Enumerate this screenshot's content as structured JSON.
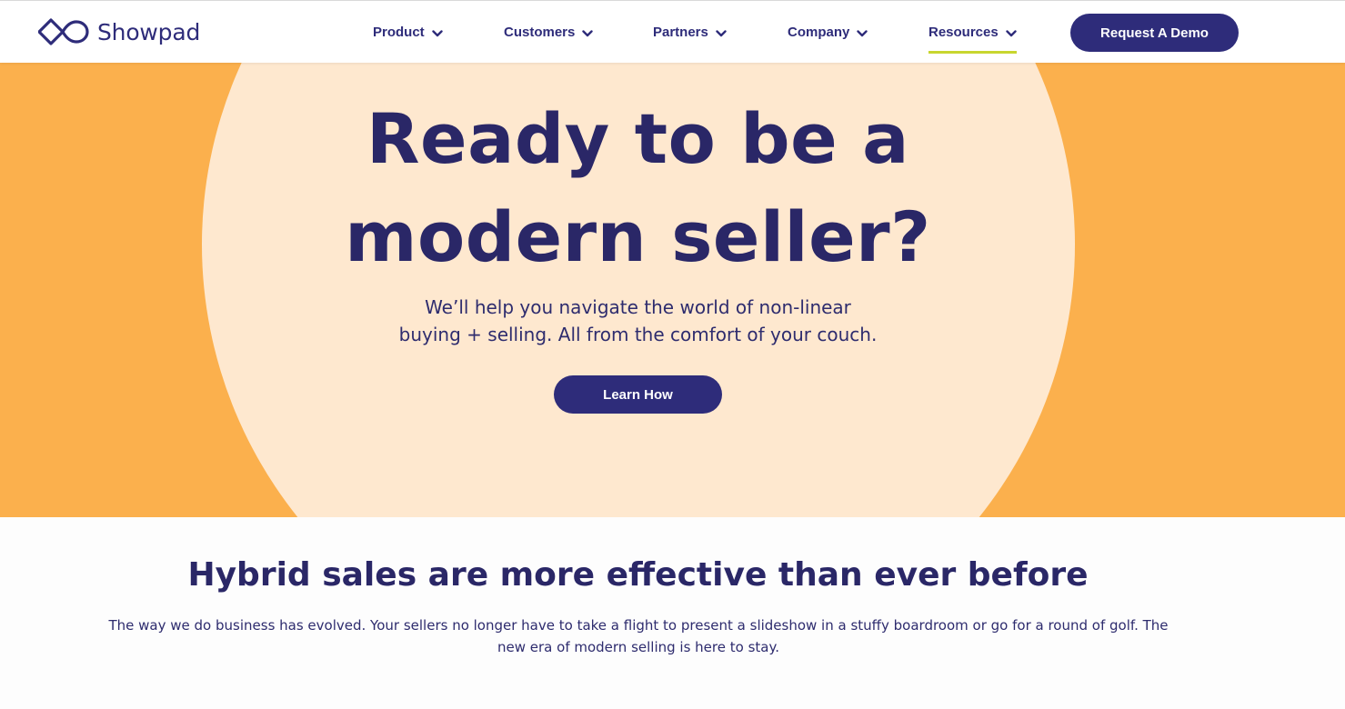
{
  "header": {
    "logo_text": "Showpad",
    "nav": [
      {
        "label": "Product"
      },
      {
        "label": "Customers"
      },
      {
        "label": "Partners"
      },
      {
        "label": "Company"
      },
      {
        "label": "Resources",
        "active": true
      }
    ],
    "cta_label": "Request A Demo"
  },
  "hero": {
    "title_line1": "Ready to be a",
    "title_line2": "modern seller?",
    "subtitle_line1": "We’ll help you navigate the world of non-linear",
    "subtitle_line2": "buying + selling. All from the comfort of your couch.",
    "button_label": "Learn How"
  },
  "section": {
    "title": "Hybrid sales are more effective than ever before",
    "text_line1": "The way we do business has evolved. Your sellers no longer have to take a flight to present a slideshow in a stuffy boardroom or go for a round of golf. The",
    "text_line2": "new era of modern selling is here to stay."
  },
  "colors": {
    "brand_navy": "#2e2c7a",
    "hero_orange": "#fbb04d",
    "hero_cream": "#fee8cf",
    "active_underline": "#c8d62f"
  },
  "icons": {
    "logo": "showpad-infinity-logo",
    "nav_chevron": "chevron-down-icon"
  }
}
